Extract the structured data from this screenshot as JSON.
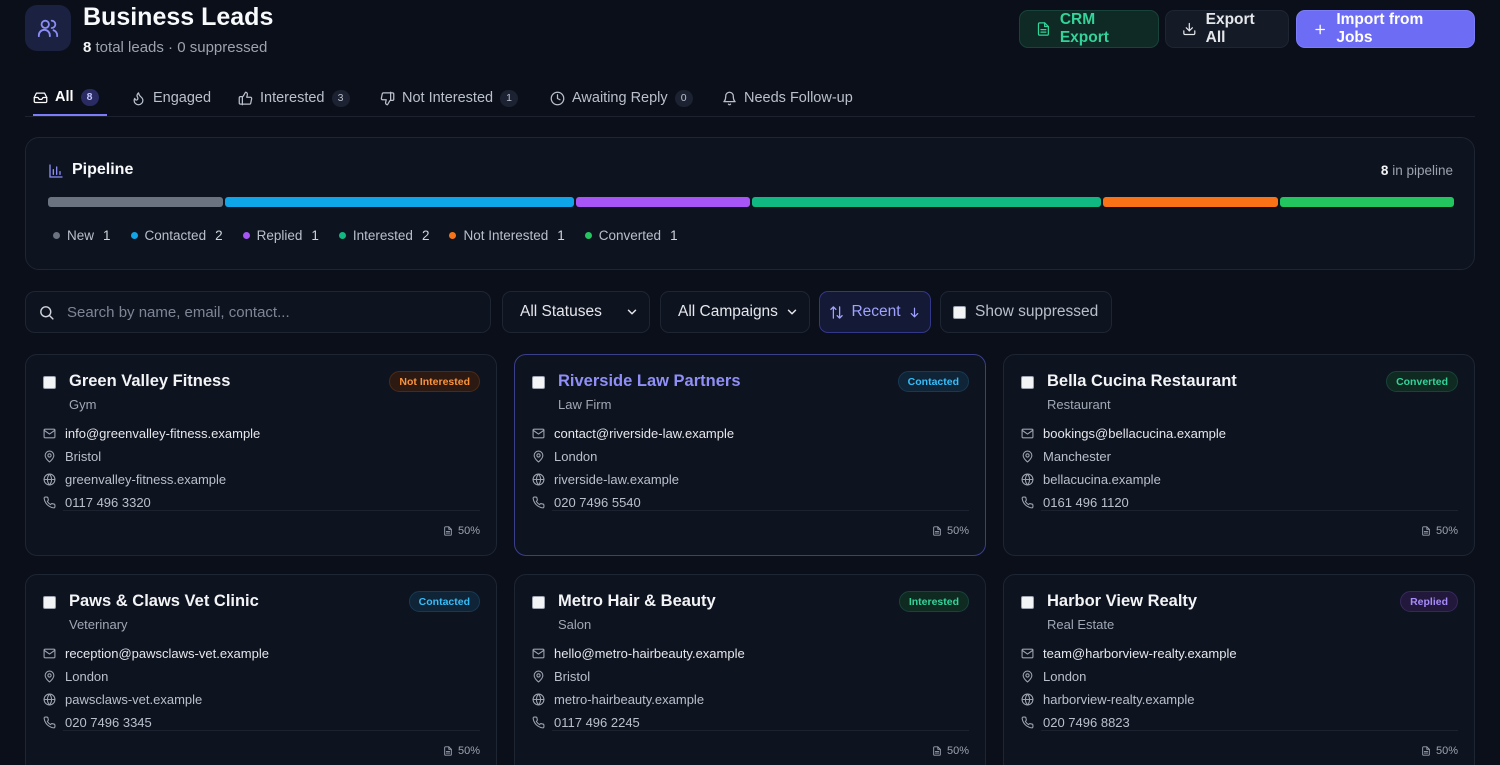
{
  "header": {
    "title": "Business Leads",
    "total_count": "8",
    "subtitle_rest": "total leads · 0 suppressed",
    "crm_export_label": "CRM Export",
    "export_all_label": "Export All",
    "import_label": "Import from Jobs"
  },
  "tabs": [
    {
      "label": "All",
      "count": "8",
      "icon": "inbox-icon"
    },
    {
      "label": "Engaged",
      "count": "",
      "icon": "flame-icon"
    },
    {
      "label": "Interested",
      "count": "3",
      "icon": "thumbs-up-icon"
    },
    {
      "label": "Not Interested",
      "count": "1",
      "icon": "thumbs-down-icon"
    },
    {
      "label": "Awaiting Reply",
      "count": "0",
      "icon": "clock-icon"
    },
    {
      "label": "Needs Follow-up",
      "count": "",
      "icon": "bell-icon"
    }
  ],
  "pipeline": {
    "title": "Pipeline",
    "count": "8",
    "count_suffix": "in pipeline",
    "stages": [
      {
        "label": "New",
        "value": "1",
        "units": 1,
        "color": "#6b7280"
      },
      {
        "label": "Contacted",
        "value": "2",
        "units": 2,
        "color": "#0ea5e9"
      },
      {
        "label": "Replied",
        "value": "1",
        "units": 1,
        "color": "#a855f7"
      },
      {
        "label": "Interested",
        "value": "2",
        "units": 2,
        "color": "#10b981"
      },
      {
        "label": "Not Interested",
        "value": "1",
        "units": 1,
        "color": "#f97316"
      },
      {
        "label": "Converted",
        "value": "1",
        "units": 1,
        "color": "#22c55e"
      }
    ]
  },
  "filters": {
    "search_placeholder": "Search by name, email, contact...",
    "status_label": "All Statuses",
    "campaign_label": "All Campaigns",
    "sort_label": "Recent",
    "suppressed_label": "Show suppressed"
  },
  "leads": [
    {
      "name": "Green Valley Fitness",
      "category": "Gym",
      "status": "Not Interested",
      "email": "info@greenvalley-fitness.example",
      "location": "Bristol",
      "website": "greenvalley-fitness.example",
      "phone": "0117 496 3320",
      "score": "50%"
    },
    {
      "name": "Riverside Law Partners",
      "category": "Law Firm",
      "status": "Contacted",
      "email": "contact@riverside-law.example",
      "location": "London",
      "website": "riverside-law.example",
      "phone": "020 7496 5540",
      "score": "50%"
    },
    {
      "name": "Bella Cucina Restaurant",
      "category": "Restaurant",
      "status": "Converted",
      "email": "bookings@bellacucina.example",
      "location": "Manchester",
      "website": "bellacucina.example",
      "phone": "0161 496 1120",
      "score": "50%"
    },
    {
      "name": "Paws & Claws Vet Clinic",
      "category": "Veterinary",
      "status": "Contacted",
      "email": "reception@pawsclaws-vet.example",
      "location": "London",
      "website": "pawsclaws-vet.example",
      "phone": "020 7496 3345",
      "score": "50%"
    },
    {
      "name": "Metro Hair & Beauty",
      "category": "Salon",
      "status": "Interested",
      "email": "hello@metro-hairbeauty.example",
      "location": "Bristol",
      "website": "metro-hairbeauty.example",
      "phone": "0117 496 2245",
      "score": "50%"
    },
    {
      "name": "Harbor View Realty",
      "category": "Real Estate",
      "status": "Replied",
      "email": "team@harborview-realty.example",
      "location": "London",
      "website": "harborview-realty.example",
      "phone": "020 7496 8823",
      "score": "50%"
    }
  ]
}
